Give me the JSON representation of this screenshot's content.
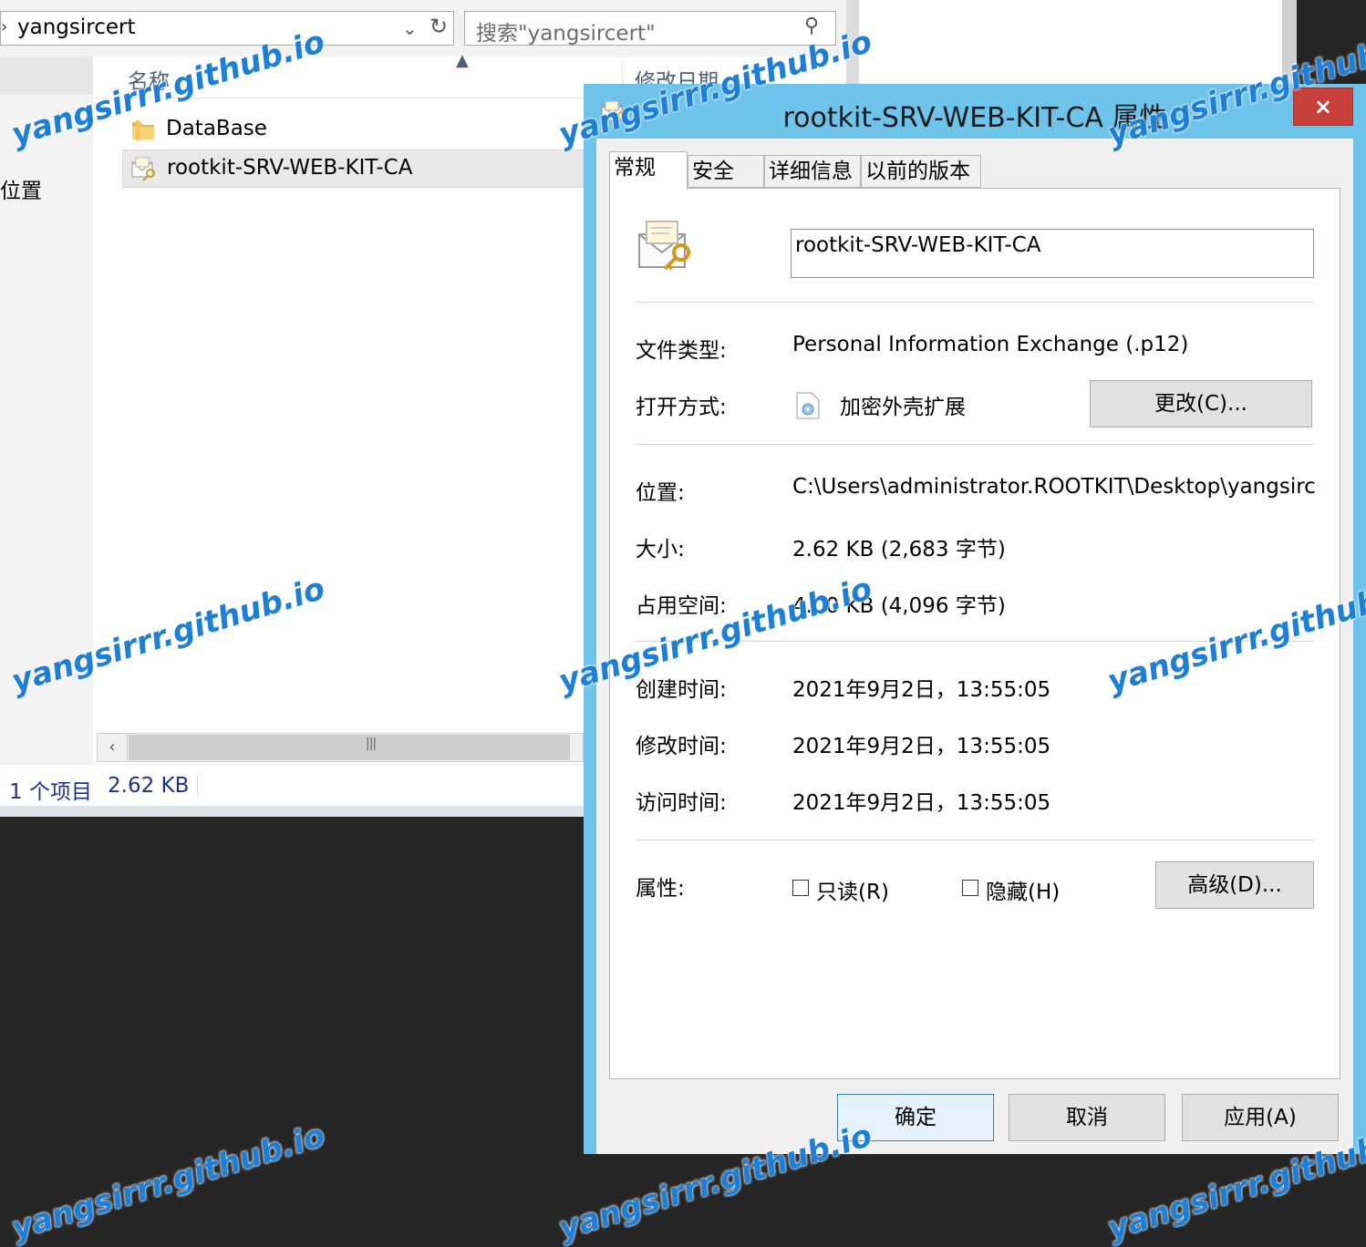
{
  "explorer": {
    "address_path": "yangsircert",
    "search_placeholder": "搜索\"yangsircert\"",
    "nav_location_label": "位置",
    "columns": {
      "name": "名称",
      "modified": "修改日期"
    },
    "files": [
      {
        "name": "DataBase",
        "icon": "folder-icon"
      },
      {
        "name": "rootkit-SRV-WEB-KIT-CA",
        "icon": "certificate-file-icon"
      }
    ],
    "status": {
      "count": "1 个项目",
      "size": "2.62 KB"
    }
  },
  "dialog": {
    "title": "rootkit-SRV-WEB-KIT-CA 属性",
    "close_label": "×",
    "tabs": [
      "常规",
      "安全",
      "详细信息",
      "以前的版本"
    ],
    "file_name": "rootkit-SRV-WEB-KIT-CA",
    "file_type_label": "文件类型:",
    "file_type": "Personal Information Exchange (.p12)",
    "open_with_label": "打开方式:",
    "open_with": "加密外壳扩展",
    "change_button": "更改(C)...",
    "location_label": "位置:",
    "location": "C:\\Users\\administrator.ROOTKIT\\Desktop\\yangsircert",
    "size_label": "大小:",
    "size": "2.62 KB (2,683 字节)",
    "size_on_disk_label": "占用空间:",
    "size_on_disk": "4.00 KB (4,096 字节)",
    "created_label": "创建时间:",
    "created": "2021年9月2日，13:55:05",
    "modified_label": "修改时间:",
    "modified": "2021年9月2日，13:55:05",
    "accessed_label": "访问时间:",
    "accessed": "2021年9月2日，13:55:05",
    "attributes_label": "属性:",
    "readonly_label": "只读(R)",
    "readonly_checked": false,
    "hidden_label": "隐藏(H)",
    "hidden_checked": false,
    "advanced_button": "高级(D)...",
    "ok_button": "确定",
    "cancel_button": "取消",
    "apply_button": "应用(A)"
  },
  "watermark": "yangsirrr.github.io",
  "colors": {
    "title_bar": "#6ec3ea",
    "close_button": "#c7403a",
    "watermark": "#1e7fd6"
  }
}
